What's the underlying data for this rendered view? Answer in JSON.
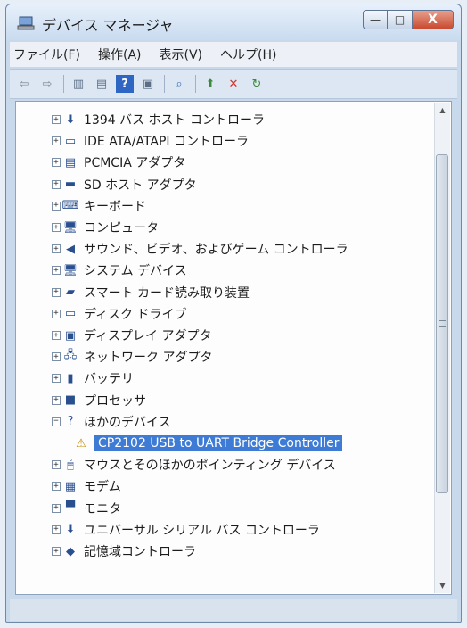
{
  "window": {
    "title": "デバイス マネージャ",
    "controls": {
      "minimize": "—",
      "maximize": "□",
      "close": "X"
    }
  },
  "menu": [
    "ファイル(F)",
    "操作(A)",
    "表示(V)",
    "ヘルプ(H)"
  ],
  "toolbar": [
    "back-arrow-icon",
    "forward-arrow-icon",
    "show-hide-tree-icon",
    "properties-icon",
    "help-icon",
    "console-icon",
    "scan-hardware-icon",
    "update-driver-icon",
    "uninstall-icon",
    "enable-device-icon"
  ],
  "tree": [
    {
      "label": "1394 バス ホスト コントローラ",
      "expander": "+",
      "icon": "firewire-icon",
      "glyph": "⬇"
    },
    {
      "label": "IDE ATA/ATAPI コントローラ",
      "expander": "+",
      "icon": "ide-controller-icon",
      "glyph": "▭"
    },
    {
      "label": "PCMCIA アダプタ",
      "expander": "+",
      "icon": "pcmcia-icon",
      "glyph": "▤"
    },
    {
      "label": "SD ホスト アダプタ",
      "expander": "+",
      "icon": "sd-card-icon",
      "glyph": "▬"
    },
    {
      "label": "キーボード",
      "expander": "+",
      "icon": "keyboard-icon",
      "glyph": "⌨"
    },
    {
      "label": "コンピュータ",
      "expander": "+",
      "icon": "computer-icon",
      "glyph": "🖥"
    },
    {
      "label": "サウンド、ビデオ、およびゲーム コントローラ",
      "expander": "+",
      "icon": "speaker-icon",
      "glyph": "◀"
    },
    {
      "label": "システム デバイス",
      "expander": "+",
      "icon": "system-device-icon",
      "glyph": "🖥"
    },
    {
      "label": "スマート カード読み取り装置",
      "expander": "+",
      "icon": "smartcard-reader-icon",
      "glyph": "▰"
    },
    {
      "label": "ディスク ドライブ",
      "expander": "+",
      "icon": "disk-drive-icon",
      "glyph": "▭"
    },
    {
      "label": "ディスプレイ アダプタ",
      "expander": "+",
      "icon": "display-adapter-icon",
      "glyph": "▣"
    },
    {
      "label": "ネットワーク アダプタ",
      "expander": "+",
      "icon": "network-adapter-icon",
      "glyph": "🖧"
    },
    {
      "label": "バッテリ",
      "expander": "+",
      "icon": "battery-icon",
      "glyph": "▮"
    },
    {
      "label": "プロセッサ",
      "expander": "+",
      "icon": "processor-icon",
      "glyph": "■"
    },
    {
      "label": "ほかのデバイス",
      "expander": "−",
      "icon": "other-devices-icon",
      "glyph": "?"
    },
    {
      "label": "CP2102 USB to UART Bridge Controller",
      "expander": "",
      "icon": "warning-device-icon",
      "glyph": "⚠",
      "child": true,
      "selected": true
    },
    {
      "label": "マウスとそのほかのポインティング デバイス",
      "expander": "+",
      "icon": "mouse-icon",
      "glyph": "🖱"
    },
    {
      "label": "モデム",
      "expander": "+",
      "icon": "modem-icon",
      "glyph": "▦"
    },
    {
      "label": "モニタ",
      "expander": "+",
      "icon": "monitor-icon",
      "glyph": "▀"
    },
    {
      "label": "ユニバーサル シリアル バス コントローラ",
      "expander": "+",
      "icon": "usb-icon",
      "glyph": "⬇"
    },
    {
      "label": "記憶域コントローラ",
      "expander": "+",
      "icon": "storage-controller-icon",
      "glyph": "◆"
    }
  ],
  "scrollbar": {
    "up": "▲",
    "down": "▼"
  }
}
